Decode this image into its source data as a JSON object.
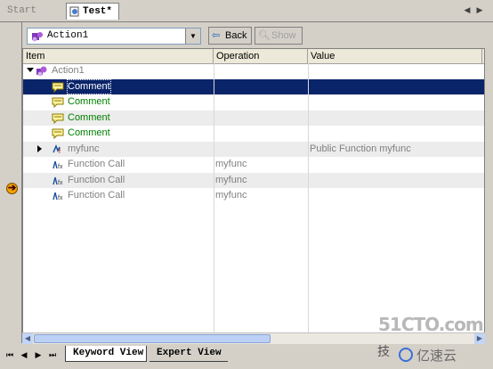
{
  "tabs": [
    {
      "label": "Start Page"
    },
    {
      "label": "Test*"
    }
  ],
  "toolbar": {
    "action_value": "Action1",
    "back_label": "Back",
    "show_label": "Show"
  },
  "columns": [
    "Item",
    "Operation",
    "Value"
  ],
  "rows": [
    {
      "item": "Action1",
      "operation": "",
      "value": "",
      "icon": "action-icon",
      "level": 0,
      "expanded": true,
      "muted": true
    },
    {
      "item": "Comment",
      "operation": "",
      "value": "",
      "icon": "comment-icon",
      "level": 1,
      "selected": true
    },
    {
      "item": "Comment",
      "operation": "",
      "value": "",
      "icon": "comment-icon",
      "level": 1
    },
    {
      "item": "Comment",
      "operation": "",
      "value": "",
      "icon": "comment-icon",
      "level": 1
    },
    {
      "item": "Comment",
      "operation": "",
      "value": "",
      "icon": "comment-icon",
      "level": 1
    },
    {
      "item": "myfunc",
      "operation": "",
      "value": "Public Function myfunc",
      "icon": "function-icon",
      "level": 1,
      "collapsed": true
    },
    {
      "item": "Function Call",
      "operation": "myfunc",
      "value": "",
      "icon": "function-call-icon",
      "level": 1
    },
    {
      "item": "Function Call",
      "operation": "myfunc",
      "value": "",
      "icon": "function-call-icon",
      "level": 1
    },
    {
      "item": "Function Call",
      "operation": "myfunc",
      "value": "",
      "icon": "function-call-icon",
      "level": 1
    }
  ],
  "bottom_tabs": [
    {
      "label": "Keyword View"
    },
    {
      "label": "Expert View"
    }
  ],
  "watermark": {
    "site": "51CTO.com",
    "brand": "亿速云",
    "extra": "技"
  },
  "colors": {
    "selection": "#0a246a",
    "comment_text": "#008000",
    "muted_text": "#808080"
  }
}
